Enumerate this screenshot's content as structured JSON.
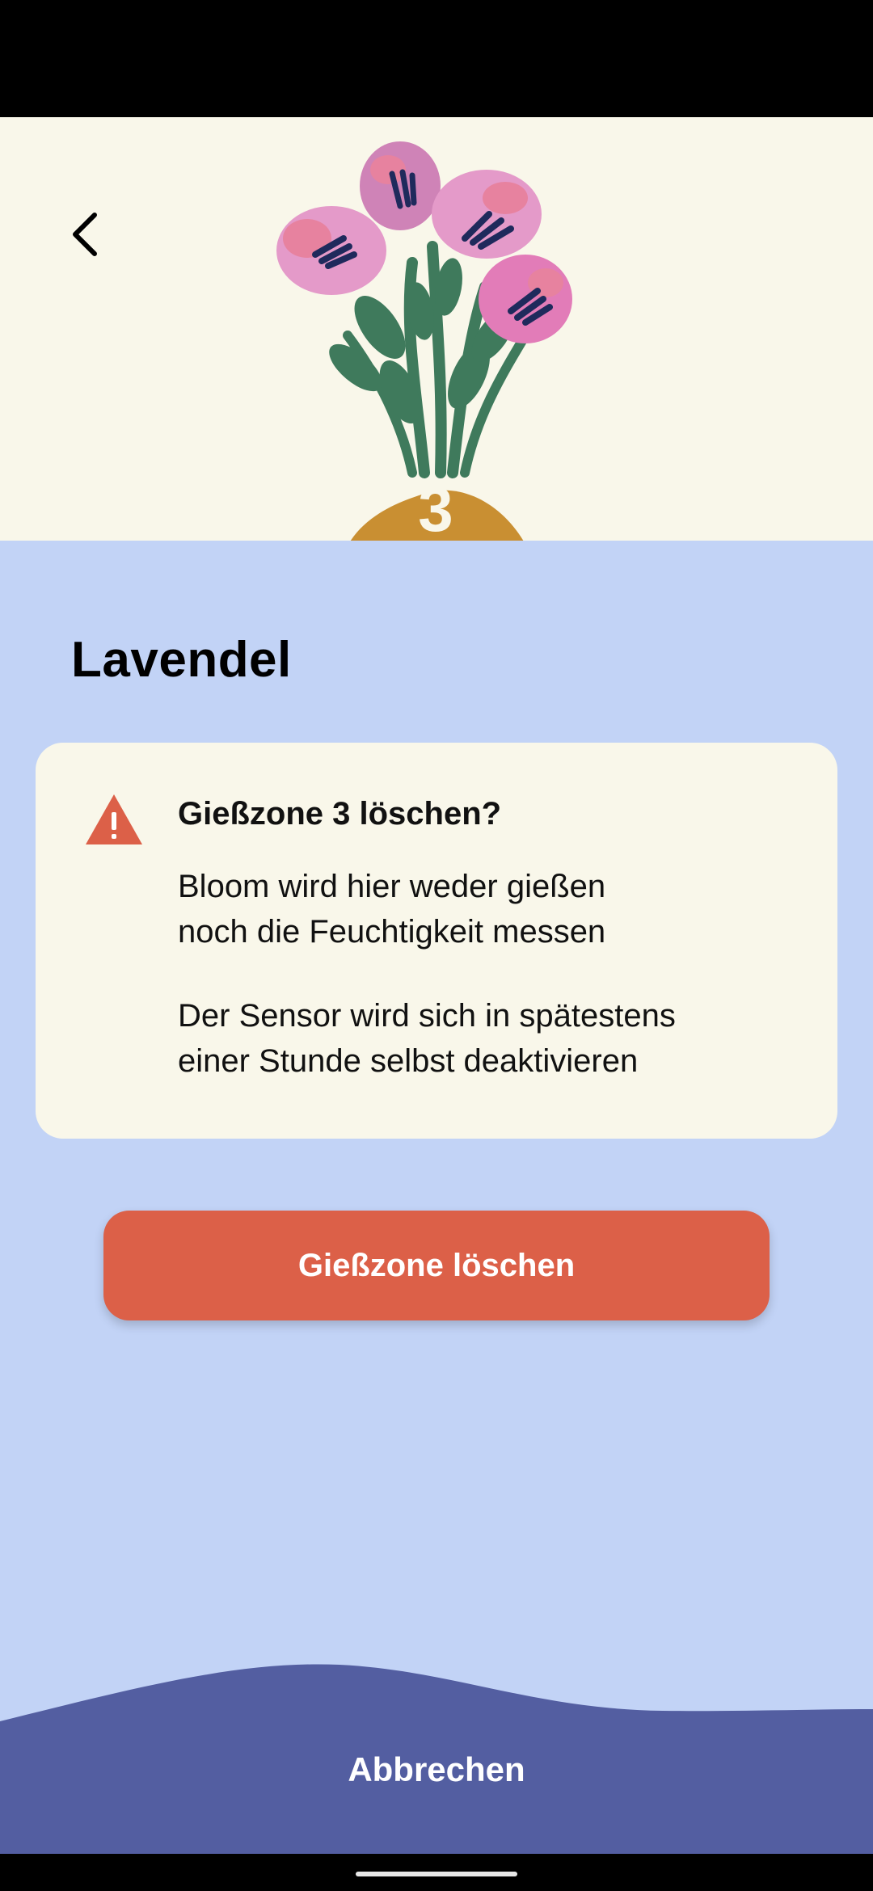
{
  "header": {
    "back_icon": "chevron-left-icon",
    "zone_number": "3"
  },
  "plant": {
    "name": "Lavendel"
  },
  "warning": {
    "icon": "warning-triangle-icon",
    "title": "Gießzone 3 löschen?",
    "text_1": "Bloom wird hier weder gießen\nnoch die Feuchtigkeit messen",
    "text_2": "Der Sensor wird sich in spätestens\neiner Stunde selbst deaktivieren"
  },
  "actions": {
    "delete_label": "Gießzone löschen",
    "cancel_label": "Abbrechen"
  },
  "colors": {
    "hero_bg": "#f9f7ea",
    "content_bg": "#c2d3f6",
    "danger": "#dc6048",
    "footer": "#535ea1",
    "mound": "#c98f32"
  }
}
